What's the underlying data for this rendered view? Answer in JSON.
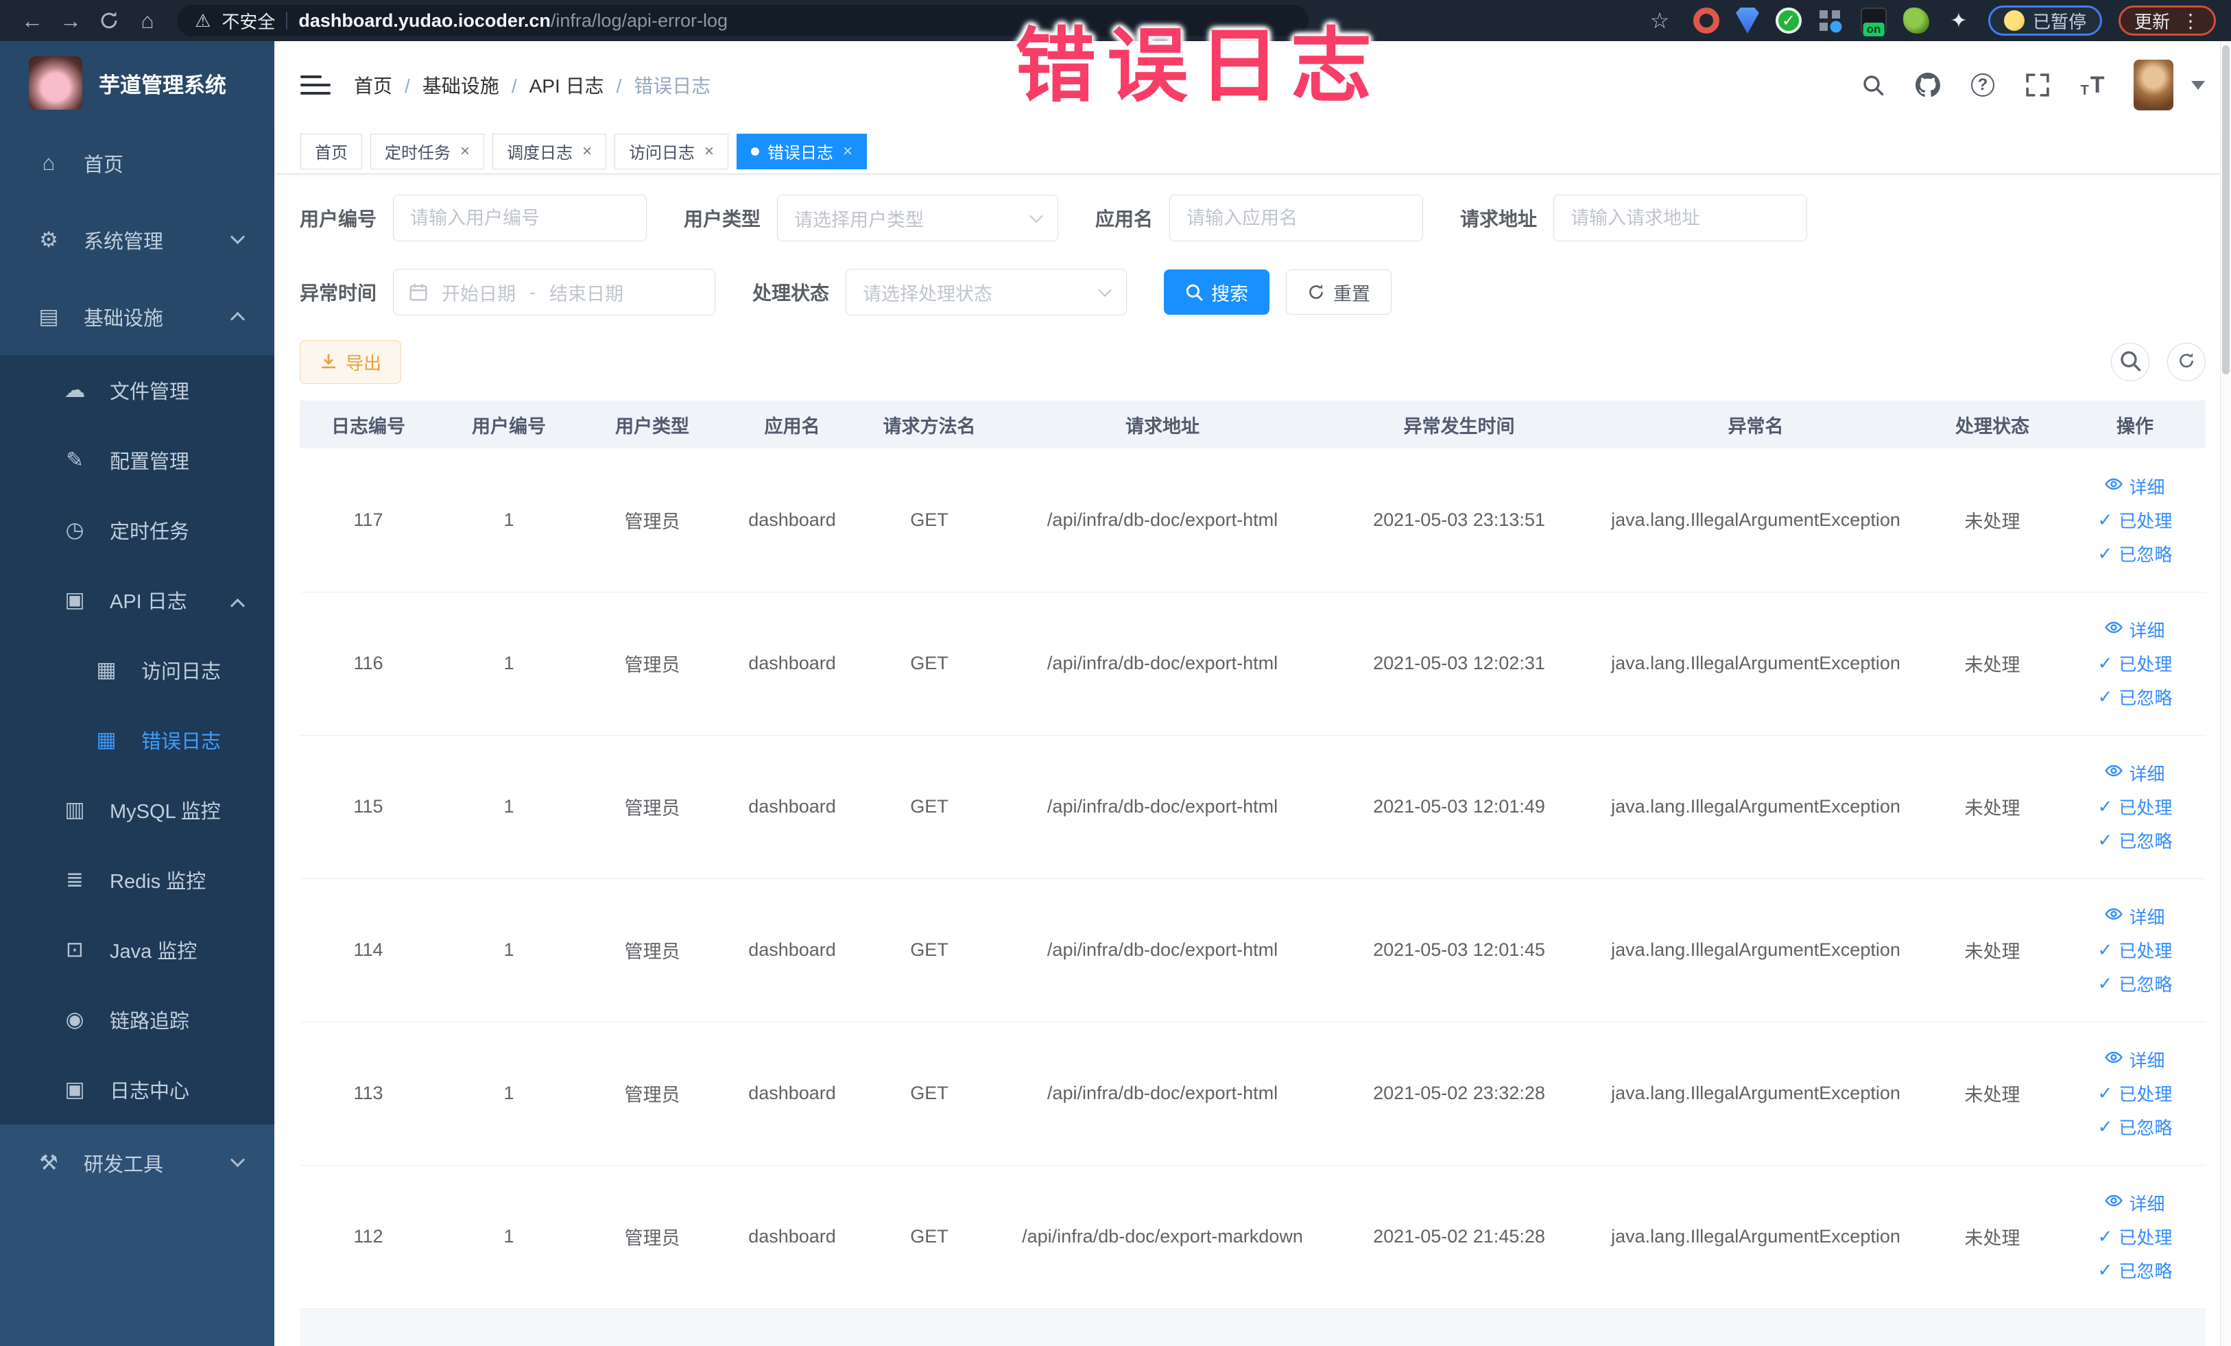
{
  "browser": {
    "security_label": "不安全",
    "url_host": "dashboard.yudao.iocoder.cn",
    "url_path": "/infra/log/api-error-log",
    "extensions": [
      {
        "name": "ext-orange-ring"
      },
      {
        "name": "ext-blue-shield"
      },
      {
        "name": "ext-green-check"
      },
      {
        "name": "ext-grid-apps"
      },
      {
        "name": "ext-dark-on",
        "badge": "on"
      },
      {
        "name": "ext-green-leaf"
      },
      {
        "name": "ext-puzzle"
      }
    ],
    "paused_pill": {
      "label": "已暂停"
    },
    "update_pill": {
      "label": "更新"
    }
  },
  "overlay": {
    "text": "错误日志"
  },
  "sidebar": {
    "title": "芋道管理系统",
    "items": [
      {
        "label": "首页",
        "icon": "home",
        "level": 0,
        "section": "top"
      },
      {
        "label": "系统管理",
        "icon": "gear",
        "level": 0,
        "section": "top",
        "chevron": "down"
      },
      {
        "label": "基础设施",
        "icon": "infra",
        "level": 0,
        "section": "top",
        "chevron": "up"
      },
      {
        "label": "文件管理",
        "icon": "file",
        "level": 1,
        "section": "sub"
      },
      {
        "label": "配置管理",
        "icon": "config",
        "level": 1,
        "section": "sub"
      },
      {
        "label": "定时任务",
        "icon": "job",
        "level": 1,
        "section": "sub"
      },
      {
        "label": "API 日志",
        "icon": "api-log",
        "level": 1,
        "section": "sub",
        "chevron": "up"
      },
      {
        "label": "访问日志",
        "icon": "access-log",
        "level": 2,
        "section": "sub"
      },
      {
        "label": "错误日志",
        "icon": "error-log",
        "level": 2,
        "section": "sub",
        "active": true
      },
      {
        "label": "MySQL 监控",
        "icon": "mysql",
        "level": 1,
        "section": "sub"
      },
      {
        "label": "Redis 监控",
        "icon": "redis",
        "level": 1,
        "section": "sub"
      },
      {
        "label": "Java 监控",
        "icon": "java",
        "level": 1,
        "section": "sub"
      },
      {
        "label": "链路追踪",
        "icon": "trace",
        "level": 1,
        "section": "sub"
      },
      {
        "label": "日志中心",
        "icon": "log-center",
        "level": 1,
        "section": "sub"
      },
      {
        "label": "研发工具",
        "icon": "devtools",
        "level": 0,
        "section": "bottom",
        "chevron": "down"
      }
    ]
  },
  "breadcrumb": {
    "items": [
      "首页",
      "基础设施",
      "API 日志",
      "错误日志"
    ]
  },
  "tabs": [
    {
      "label": "首页",
      "closable": false,
      "active": false
    },
    {
      "label": "定时任务",
      "closable": true,
      "active": false
    },
    {
      "label": "调度日志",
      "closable": true,
      "active": false
    },
    {
      "label": "访问日志",
      "closable": true,
      "active": false
    },
    {
      "label": "错误日志",
      "closable": true,
      "active": true
    }
  ],
  "filters": {
    "user_id": {
      "label": "用户编号",
      "placeholder": "请输入用户编号"
    },
    "user_type": {
      "label": "用户类型",
      "placeholder": "请选择用户类型"
    },
    "app_name": {
      "label": "应用名",
      "placeholder": "请输入应用名"
    },
    "request_url": {
      "label": "请求地址",
      "placeholder": "请输入请求地址"
    },
    "exception_time": {
      "label": "异常时间",
      "start_placeholder": "开始日期",
      "separator": "-",
      "end_placeholder": "结束日期"
    },
    "process_status": {
      "label": "处理状态",
      "placeholder": "请选择处理状态"
    },
    "search_button": "搜索",
    "reset_button": "重置"
  },
  "toolbar": {
    "export_button": "导出"
  },
  "table": {
    "columns": [
      "日志编号",
      "用户编号",
      "用户类型",
      "应用名",
      "请求方法名",
      "请求地址",
      "异常发生时间",
      "异常名",
      "处理状态",
      "操作"
    ],
    "row_actions": [
      {
        "label": "详细",
        "icon": "eye"
      },
      {
        "label": "已处理",
        "icon": "check"
      },
      {
        "label": "已忽略",
        "icon": "check"
      }
    ],
    "rows": [
      {
        "id": "117",
        "user_id": "1",
        "user_type": "管理员",
        "app": "dashboard",
        "method": "GET",
        "url": "/api/infra/db-doc/export-html",
        "time": "2021-05-03 23:13:51",
        "exception": "java.lang.IllegalArgumentException",
        "status": "未处理"
      },
      {
        "id": "116",
        "user_id": "1",
        "user_type": "管理员",
        "app": "dashboard",
        "method": "GET",
        "url": "/api/infra/db-doc/export-html",
        "time": "2021-05-03 12:02:31",
        "exception": "java.lang.IllegalArgumentException",
        "status": "未处理"
      },
      {
        "id": "115",
        "user_id": "1",
        "user_type": "管理员",
        "app": "dashboard",
        "method": "GET",
        "url": "/api/infra/db-doc/export-html",
        "time": "2021-05-03 12:01:49",
        "exception": "java.lang.IllegalArgumentException",
        "status": "未处理"
      },
      {
        "id": "114",
        "user_id": "1",
        "user_type": "管理员",
        "app": "dashboard",
        "method": "GET",
        "url": "/api/infra/db-doc/export-html",
        "time": "2021-05-03 12:01:45",
        "exception": "java.lang.IllegalArgumentException",
        "status": "未处理"
      },
      {
        "id": "113",
        "user_id": "1",
        "user_type": "管理员",
        "app": "dashboard",
        "method": "GET",
        "url": "/api/infra/db-doc/export-html",
        "time": "2021-05-02 23:32:28",
        "exception": "java.lang.IllegalArgumentException",
        "status": "未处理"
      },
      {
        "id": "112",
        "user_id": "1",
        "user_type": "管理员",
        "app": "dashboard",
        "method": "GET",
        "url": "/api/infra/db-doc/export-markdown",
        "time": "2021-05-02 21:45:28",
        "exception": "java.lang.IllegalArgumentException",
        "status": "未处理"
      }
    ]
  },
  "colors": {
    "primary": "#1890ff",
    "warning_button": "#e6a23c",
    "overlay_pink": "#f83d66",
    "sidebar_active": "#3f9eff"
  }
}
